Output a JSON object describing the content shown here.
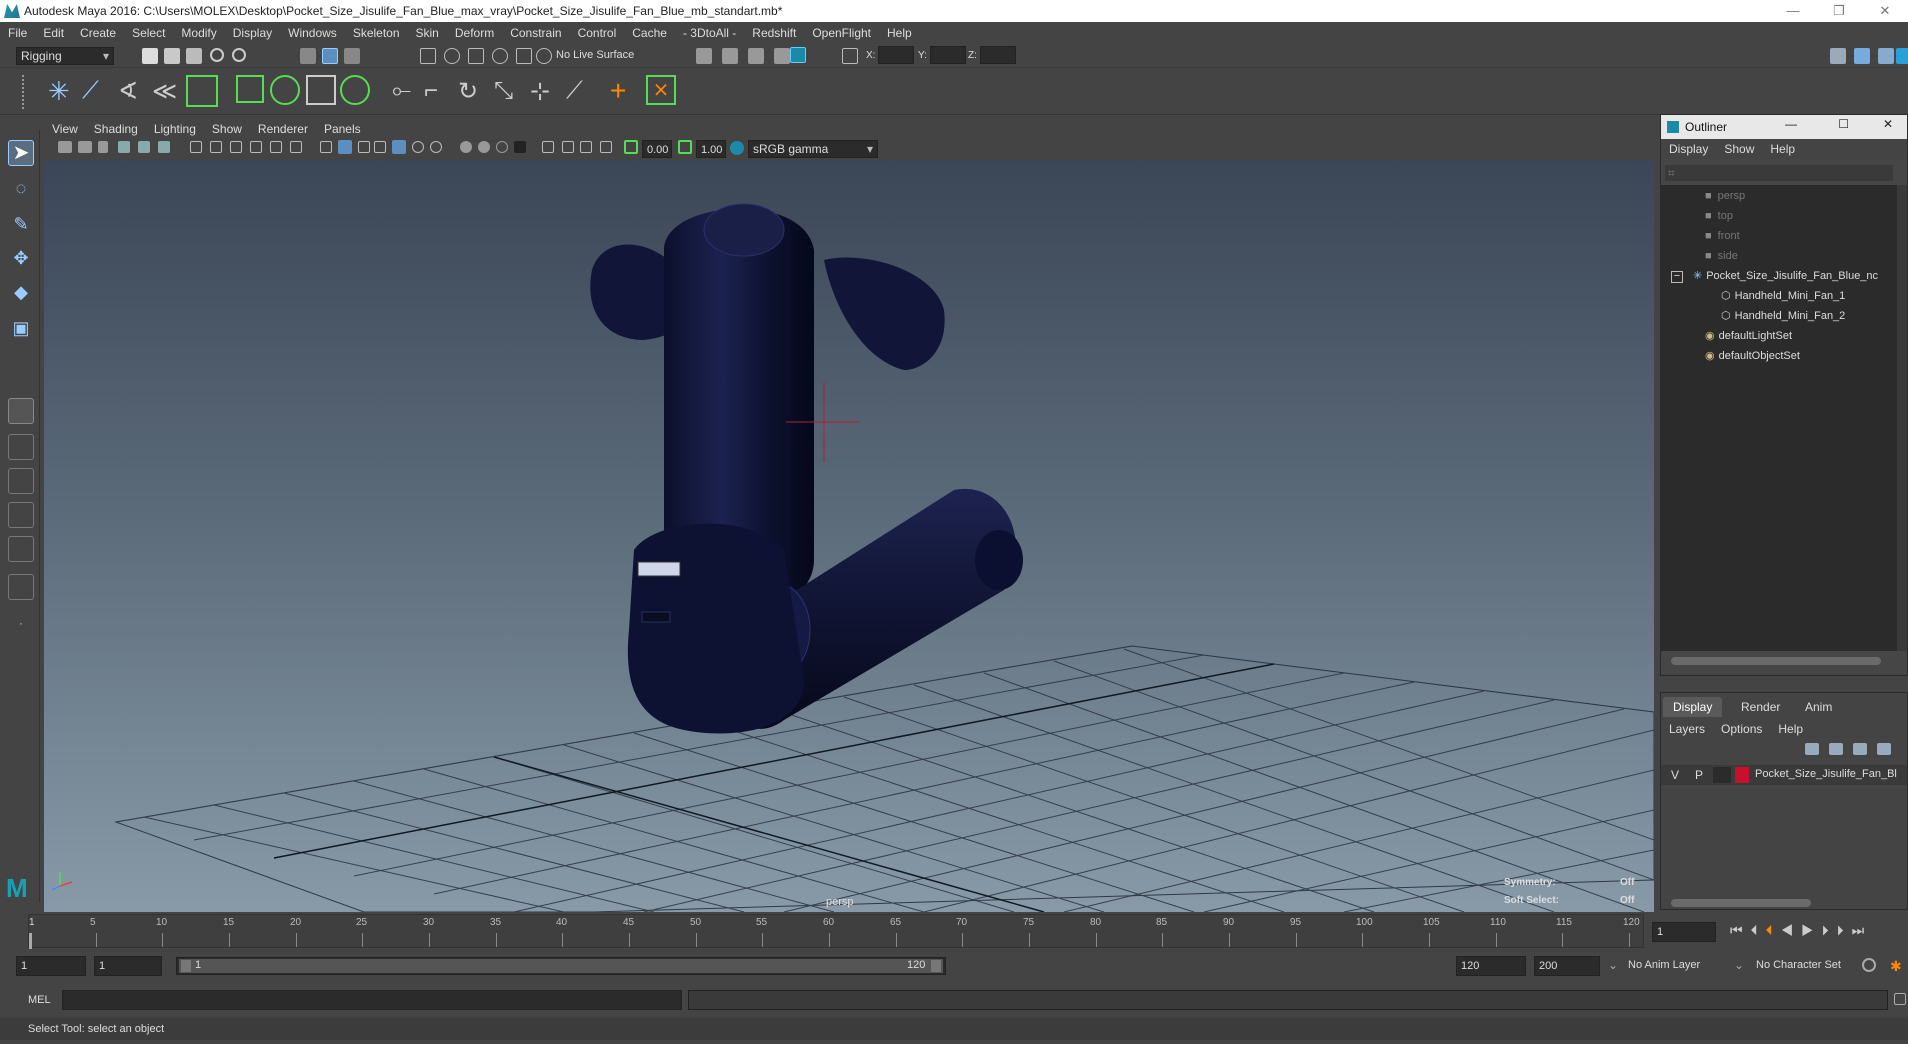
{
  "window": {
    "title": "Autodesk Maya 2016: C:\\Users\\MOLEX\\Desktop\\Pocket_Size_Jisulife_Fan_Blue_max_vray\\Pocket_Size_Jisulife_Fan_Blue_mb_standart.mb*",
    "minimize": "—",
    "restore": "❐",
    "close": "✕"
  },
  "menubar": [
    "File",
    "Edit",
    "Create",
    "Select",
    "Modify",
    "Display",
    "Windows",
    "Skeleton",
    "Skin",
    "Deform",
    "Constrain",
    "Control",
    "Cache",
    "- 3DtoAll -",
    "Redshift",
    "OpenFlight",
    "Help"
  ],
  "shelf": {
    "mode": "Rigging",
    "live_surface": "No Live Surface",
    "x_label": "X:",
    "y_label": "Y:",
    "z_label": "Z:"
  },
  "viewport_menu": [
    "View",
    "Shading",
    "Lighting",
    "Show",
    "Renderer",
    "Panels"
  ],
  "viewport_bar": {
    "exposure": "0.00",
    "gamma": "1.00",
    "color_space": "sRGB gamma"
  },
  "viewport": {
    "camera": "persp",
    "symmetry_label": "Symmetry:",
    "symmetry_value": "Off",
    "soft_select_label": "Soft Select:",
    "soft_select_value": "Off",
    "accent": "#0d1232"
  },
  "outliner": {
    "title": "Outliner",
    "menu": [
      "Display",
      "Show",
      "Help"
    ],
    "items": [
      {
        "label": "persp",
        "icon": "camera-icon",
        "dim": true
      },
      {
        "label": "top",
        "icon": "camera-icon",
        "dim": true
      },
      {
        "label": "front",
        "icon": "camera-icon",
        "dim": true
      },
      {
        "label": "side",
        "icon": "camera-icon",
        "dim": true
      },
      {
        "label": "Pocket_Size_Jisulife_Fan_Blue_nc",
        "icon": "group-icon",
        "dim": false
      },
      {
        "label": "Handheld_Mini_Fan_1",
        "icon": "mesh-icon",
        "dim": false
      },
      {
        "label": "Handheld_Mini_Fan_2",
        "icon": "mesh-icon",
        "dim": false
      },
      {
        "label": "defaultLightSet",
        "icon": "set-icon",
        "dim": false
      },
      {
        "label": "defaultObjectSet",
        "icon": "set-icon",
        "dim": false
      }
    ]
  },
  "layers": {
    "tabs": [
      "Display",
      "Render",
      "Anim"
    ],
    "menu": [
      "Layers",
      "Options",
      "Help"
    ],
    "row": {
      "v": "V",
      "p": "P",
      "name": "Pocket_Size_Jisulife_Fan_Bl",
      "color": "#c8102e"
    }
  },
  "timeline": {
    "ticks": [
      "5",
      "10",
      "15",
      "20",
      "25",
      "30",
      "35",
      "40",
      "45",
      "50",
      "55",
      "60",
      "65",
      "70",
      "75",
      "80",
      "85",
      "90",
      "95",
      "100",
      "105",
      "110",
      "115",
      "120"
    ],
    "start_tick": "1",
    "current_frame": "1"
  },
  "range": {
    "start": "1",
    "playback_start": "1",
    "slider_start": "1",
    "slider_end": "120",
    "playback_end": "120",
    "end": "200",
    "anim_layer": "No Anim Layer",
    "character_set": "No Character Set"
  },
  "mel": {
    "label": "MEL"
  },
  "status": {
    "text": "Select Tool: select an object"
  }
}
